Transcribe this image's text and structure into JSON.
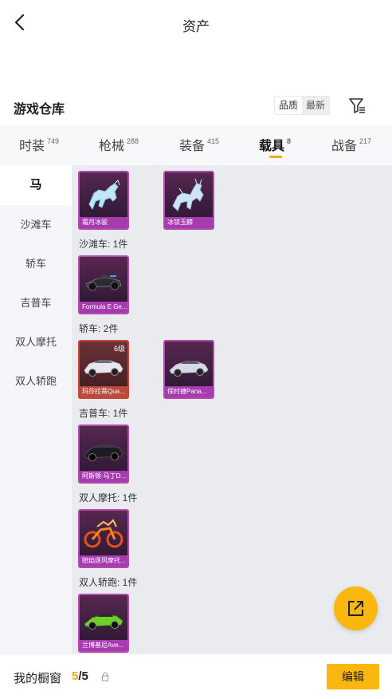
{
  "header": {
    "title": "资产"
  },
  "section": {
    "title": "游戏仓库",
    "sort_options": [
      "品质",
      "最新"
    ]
  },
  "tabs": [
    {
      "label": "时装",
      "count": "749"
    },
    {
      "label": "枪械",
      "count": "288"
    },
    {
      "label": "装备",
      "count": "415"
    },
    {
      "label": "载具",
      "count": "8"
    },
    {
      "label": "战备",
      "count": "217"
    }
  ],
  "active_tab": "载具",
  "sidebar": {
    "items": [
      "马",
      "沙滩车",
      "轿车",
      "吉普车",
      "双人摩托",
      "双人轿跑"
    ],
    "active": "马"
  },
  "groups": [
    {
      "label": "",
      "items": [
        {
          "name": "霜月冰骏"
        },
        {
          "name": "冰锁玉麟"
        }
      ]
    },
    {
      "label": "沙滩车: 1件",
      "items": [
        {
          "name": "Formula E Ge..."
        }
      ]
    },
    {
      "label": "轿车: 2件",
      "items": [
        {
          "name": "玛莎拉蒂Qua...",
          "level": "6级"
        },
        {
          "name": "保时捷Pana..."
        }
      ]
    },
    {
      "label": "吉普车: 1件",
      "items": [
        {
          "name": "阿斯顿·马丁D..."
        }
      ]
    },
    {
      "label": "双人摩托: 1件",
      "items": [
        {
          "name": "赔焰逐风摩托..."
        }
      ]
    },
    {
      "label": "双人轿跑: 1件",
      "items": [
        {
          "name": "兰博基尼Ave..."
        }
      ]
    }
  ],
  "bottom": {
    "label": "我的橱窗",
    "count_current": "5",
    "count_total": "/5",
    "edit_label": "编辑"
  },
  "colors": {
    "accent": "#f9b70f",
    "card_frame": "#b24ab0",
    "card_frame_red": "#c9473a"
  },
  "icons": {
    "back": "chevron-left-icon",
    "filter": "filter-icon",
    "share": "share-external-icon",
    "lock": "lock-icon"
  }
}
